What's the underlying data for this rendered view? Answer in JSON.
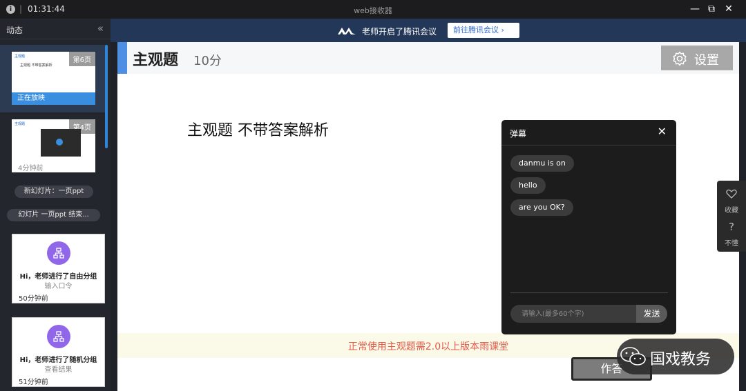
{
  "titlebar": {
    "info_icon": "info-icon",
    "time": "01:31:44",
    "title": "web接收器",
    "minimize": "—",
    "restore": "⧉",
    "close": "✕"
  },
  "sidebar": {
    "header": "动态",
    "collapse_icon": "«",
    "slides": [
      {
        "page": "第6页",
        "status": "正在放映",
        "mini_title": "主观题",
        "mini_text": "主观题 不带答案解析"
      },
      {
        "page": "第4页",
        "time": "4分钟前",
        "mini_title": "主观题"
      }
    ],
    "events": [
      {
        "label": "新幻灯片：一页ppt"
      },
      {
        "label": "幻灯片 一页ppt 结束..."
      }
    ],
    "cards": [
      {
        "title": "Hi，老师进行了自由分组",
        "action": "输入口令",
        "time": "50分钟前"
      },
      {
        "title": "Hi，老师进行了随机分组",
        "action": "查看结果",
        "time": "51分钟前"
      }
    ]
  },
  "meeting_bar": {
    "message": "老师开启了腾讯会议",
    "button": "前往腾讯会议 ›"
  },
  "question": {
    "title": "主观题",
    "score": "10分",
    "settings": "设置",
    "body": "主观题 不带答案解析",
    "notice": "正常使用主观题需2.0以上版本雨课堂",
    "answer_button": "作答"
  },
  "danmu": {
    "title": "弹幕",
    "close": "✕",
    "messages": [
      "danmu is on",
      "hello",
      "are you OK?"
    ],
    "input_placeholder": "请输入(最多60个字)",
    "send": "发送"
  },
  "side_tools": {
    "favorite": "收藏",
    "confused": "不懂",
    "favorite_icon": "heart-icon",
    "confused_icon": "question-icon"
  },
  "watermark": {
    "text": "国戏教务",
    "icon": "wechat-icon"
  },
  "colors": {
    "accent": "#4f8fe3",
    "meeting_bar": "#233758",
    "notice_text": "#e25a48",
    "group_icon": "#9167e9"
  }
}
